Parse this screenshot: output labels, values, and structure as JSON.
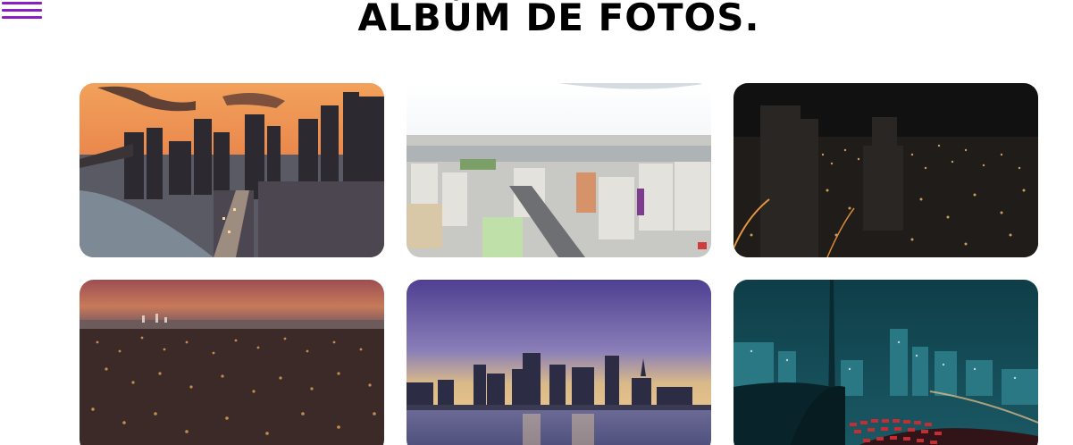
{
  "header": {
    "title": "ALBÚM DE FOTOS.",
    "menu_icon": "hamburger-menu-icon",
    "accent_color": "#8a1fc2"
  },
  "gallery": {
    "photos": [
      {
        "name": "photo-city-sunset-bridge"
      },
      {
        "name": "photo-city-daytime-aerial"
      },
      {
        "name": "photo-city-night-lights"
      },
      {
        "name": "photo-city-dusk-panorama"
      },
      {
        "name": "photo-skyline-waterfront"
      },
      {
        "name": "photo-night-skyline-stadium"
      }
    ]
  }
}
